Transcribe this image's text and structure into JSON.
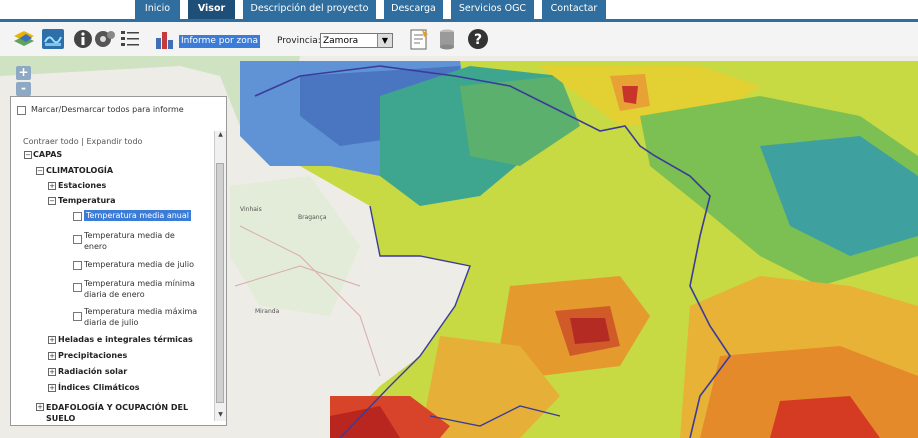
{
  "nav": {
    "tabs": [
      {
        "label": "Inicio"
      },
      {
        "label": "Visor"
      },
      {
        "label": "Descripción del proyecto"
      },
      {
        "label": "Descarga"
      },
      {
        "label": "Servicios OGC"
      },
      {
        "label": "Contactar"
      }
    ]
  },
  "toolbar": {
    "informe_label": "Informe por zona",
    "provincia_label": "Provincia:",
    "provincia_value": "Zamora",
    "icons": [
      "layers-icon",
      "map-icon",
      "info-icon",
      "tools-icon",
      "list-icon",
      "chart-icon",
      "report-icon",
      "print-icon",
      "delete-icon",
      "help-icon"
    ]
  },
  "map": {
    "zoom_in": "+",
    "zoom_out": "-",
    "places": [
      "Bragança",
      "Vinhais",
      "Miranda"
    ]
  },
  "panel": {
    "select_all": "Marcar/Desmarcar todos para informe",
    "collapse_all": "Contraer todo",
    "separator": "|",
    "expand_all": "Expandir todo",
    "root": "CAPAS",
    "climatologia": "CLIMATOLOGÍA",
    "estaciones": "Estaciones",
    "temperatura": "Temperatura",
    "layers": [
      {
        "label": "Temperatura media anual",
        "line1": "Temperatura media anual",
        "line2": ""
      },
      {
        "label": "Temperatura media de enero",
        "line1": "Temperatura media de",
        "line2": "enero"
      },
      {
        "label": "Temperatura media de julio",
        "line1": "Temperatura media de julio",
        "line2": ""
      },
      {
        "label": "Temperatura media mínima diaria de enero",
        "line1": "Temperatura media mínima",
        "line2": "diaria de enero"
      },
      {
        "label": "Temperatura media máxima diaria de julio",
        "line1": "Temperatura media máxima",
        "line2": "diaria de julio"
      }
    ],
    "heladas": "Heladas e integrales térmicas",
    "precipitaciones": "Precipitaciones",
    "radiacion": "Radiación solar",
    "indices": "Índices Climáticos",
    "edafologia_1": "EDAFOLOGÍA Y OCUPACIÓN DEL",
    "edafologia_2": "SUELO"
  },
  "colors": {
    "nav": "#2f6e9e",
    "nav_active": "#1d4f78",
    "highlight": "#3b7cd8"
  }
}
